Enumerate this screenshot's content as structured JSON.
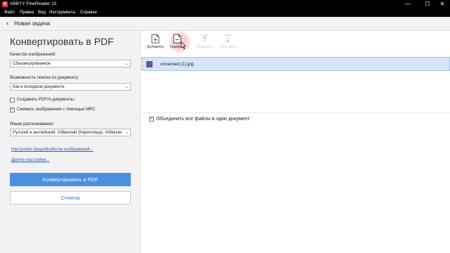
{
  "window": {
    "title": "ABBYY FineReader 15",
    "logo_text": "A",
    "controls": {
      "minimize": "—",
      "maximize": "☐",
      "close": "✕"
    }
  },
  "menu": {
    "file": "Файл",
    "edit": "Правка",
    "view": "Вид",
    "tools": "Инструменты",
    "help": "Справка"
  },
  "nav": {
    "back_icon": "‹",
    "back_label": "Новая задача"
  },
  "panel": {
    "title": "Конвертировать в PDF",
    "image_quality": {
      "label": "Качество изображений:",
      "value": "Сбалансированное"
    },
    "searchability": {
      "label": "Возможность поиска по документу:",
      "value": "Как в исходном документе"
    },
    "pdfa": {
      "label": "Создавать PDF/A-документы",
      "checked": false
    },
    "mrc": {
      "label": "Сжимать изображения с помощью MRC",
      "checked": true
    },
    "languages": {
      "label": "Языки распознавания:",
      "value": "Русский и английский; Узбекский (Кириллица); Узбекский (Ла"
    },
    "links": {
      "preprocess": "Настройки предобработки изображений...",
      "other": "Другие настройки..."
    },
    "convert_button": "Конвертировать в PDF",
    "cancel_button": "Отмена"
  },
  "toolbar": {
    "add": "Добавить",
    "delete": "Удалить",
    "up": "Поднять",
    "down": "Опустить"
  },
  "files": [
    {
      "name": "unnamed (1).jpg",
      "icon": "image-file-icon",
      "selected": true
    }
  ],
  "merge": {
    "label": "Объединить все файлы в один документ",
    "checked": true
  },
  "colors": {
    "accent": "#4b8fe0",
    "selection": "#d6e5f7",
    "logo": "#e43b2c"
  }
}
